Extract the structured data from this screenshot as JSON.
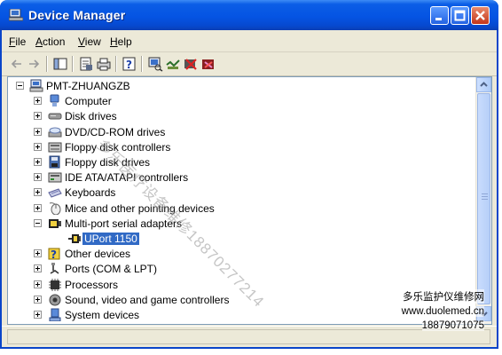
{
  "window": {
    "title": "Device Manager"
  },
  "menu": [
    {
      "label": "File",
      "accel": "F",
      "rest": "ile"
    },
    {
      "label": "Action",
      "accel": "A",
      "rest": "ction"
    },
    {
      "label": "View",
      "accel": "V",
      "rest": "iew"
    },
    {
      "label": "Help",
      "accel": "H",
      "rest": "elp"
    }
  ],
  "tree": {
    "root": "PMT-ZHUANGZB",
    "items": [
      {
        "label": "Computer",
        "icon": "computer-icon",
        "expanded": false
      },
      {
        "label": "Disk drives",
        "icon": "disk-drive-icon",
        "expanded": false
      },
      {
        "label": "DVD/CD-ROM drives",
        "icon": "cd-rom-icon",
        "expanded": false
      },
      {
        "label": "Floppy disk controllers",
        "icon": "floppy-controller-icon",
        "expanded": false
      },
      {
        "label": "Floppy disk drives",
        "icon": "floppy-drive-icon",
        "expanded": false
      },
      {
        "label": "IDE ATA/ATAPI controllers",
        "icon": "ide-controller-icon",
        "expanded": false
      },
      {
        "label": "Keyboards",
        "icon": "keyboard-icon",
        "expanded": false
      },
      {
        "label": "Mice and other pointing devices",
        "icon": "mouse-icon",
        "expanded": false
      },
      {
        "label": "Multi-port serial adapters",
        "icon": "serial-adapter-icon",
        "expanded": true
      },
      {
        "label": "UPort 1150",
        "icon": "serial-port-device-icon",
        "child": true,
        "selected": true
      },
      {
        "label": "Other devices",
        "icon": "unknown-device-icon",
        "expanded": false
      },
      {
        "label": "Ports (COM & LPT)",
        "icon": "port-icon",
        "expanded": false
      },
      {
        "label": "Processors",
        "icon": "processor-icon",
        "expanded": false
      },
      {
        "label": "Sound, video and game controllers",
        "icon": "sound-icon",
        "expanded": false
      },
      {
        "label": "System devices",
        "icon": "system-devices-icon",
        "expanded": false
      }
    ]
  },
  "watermark": {
    "diagonal": "多乐医疗设备维修18870277214",
    "line1": "多乐监护仪维修网",
    "line2": "www.duolemed.cn",
    "line3": "18879071075"
  },
  "colors": {
    "title_bar": "#0554e3",
    "selection": "#316ac5",
    "window_face": "#ece9d8"
  }
}
